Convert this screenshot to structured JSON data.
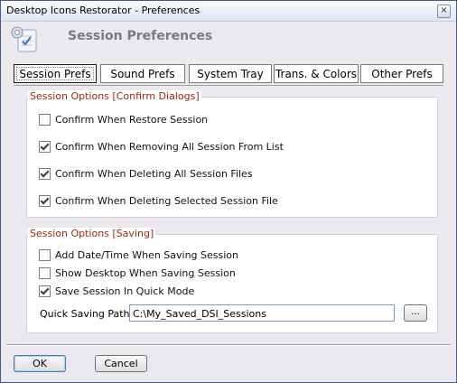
{
  "window": {
    "title": "Desktop Icons Restorator - Preferences",
    "close_glyph": "×"
  },
  "header": {
    "title": "Session Preferences",
    "icon": "preferences-app-icon"
  },
  "tabs": [
    {
      "label": "Session Prefs",
      "active": true
    },
    {
      "label": "Sound Prefs",
      "active": false
    },
    {
      "label": "System Tray",
      "active": false
    },
    {
      "label": "Trans. & Colors",
      "active": false
    },
    {
      "label": "Other Prefs",
      "active": false
    }
  ],
  "confirm_group": {
    "title": "Session Options [Confirm Dialogs]",
    "options": [
      {
        "label": "Confirm When Restore Session",
        "checked": false
      },
      {
        "label": "Confirm When Removing All Session From List",
        "checked": true
      },
      {
        "label": "Confirm When Deleting All Session Files",
        "checked": true
      },
      {
        "label": "Confirm When Deleting Selected Session File",
        "checked": true
      }
    ]
  },
  "saving_group": {
    "title": "Session Options [Saving]",
    "options": [
      {
        "label": "Add Date/Time When Saving Session",
        "checked": false
      },
      {
        "label": "Show Desktop When Saving Session",
        "checked": false
      },
      {
        "label": "Save Session In Quick Mode",
        "checked": true
      }
    ],
    "path_label": "Quick Saving Path:",
    "path_value": "C:\\My_Saved_DSI_Sessions",
    "browse_label": "..."
  },
  "buttons": {
    "ok": "OK",
    "cancel": "Cancel"
  },
  "colors": {
    "group_title": "#9b2a0e",
    "title_gray": "#7a7a7a",
    "input_border": "#7f9db9"
  }
}
